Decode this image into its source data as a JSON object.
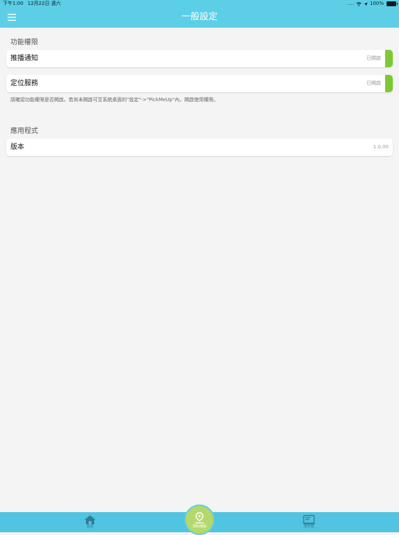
{
  "status_bar": {
    "time": "下午1:00",
    "date": "12月22日 週六",
    "battery_percent": "100%"
  },
  "header": {
    "title": "一般設定",
    "menu_icon": "hamburger-menu-icon"
  },
  "sections": {
    "permissions": {
      "title": "功能權限",
      "items": [
        {
          "label": "推播通知",
          "value": "已開啟"
        },
        {
          "label": "定位服務",
          "value": "已開啟"
        }
      ],
      "note": "請確認功能權限是否開啟。若尚未開啟可至系統桌面的\"設定\"->\"PickMeUp\"內，開啟使用權限。"
    },
    "app": {
      "title": "應用程式",
      "items": [
        {
          "label": "版本",
          "value": "1.0.00"
        }
      ]
    }
  },
  "tab_bar": {
    "home_label": "首頁",
    "home_icon": "home-icon",
    "center_label": "預約接駁",
    "center_icon": "location-pin-icon",
    "box_label": "收件匣",
    "box_icon": "inbox-icon"
  },
  "colors": {
    "header": "#5ccfe6",
    "tab_bar": "#50c4e0",
    "enabled_indicator": "#7cc932",
    "center_button": "#b4d86b",
    "background": "#f4f4f4"
  }
}
